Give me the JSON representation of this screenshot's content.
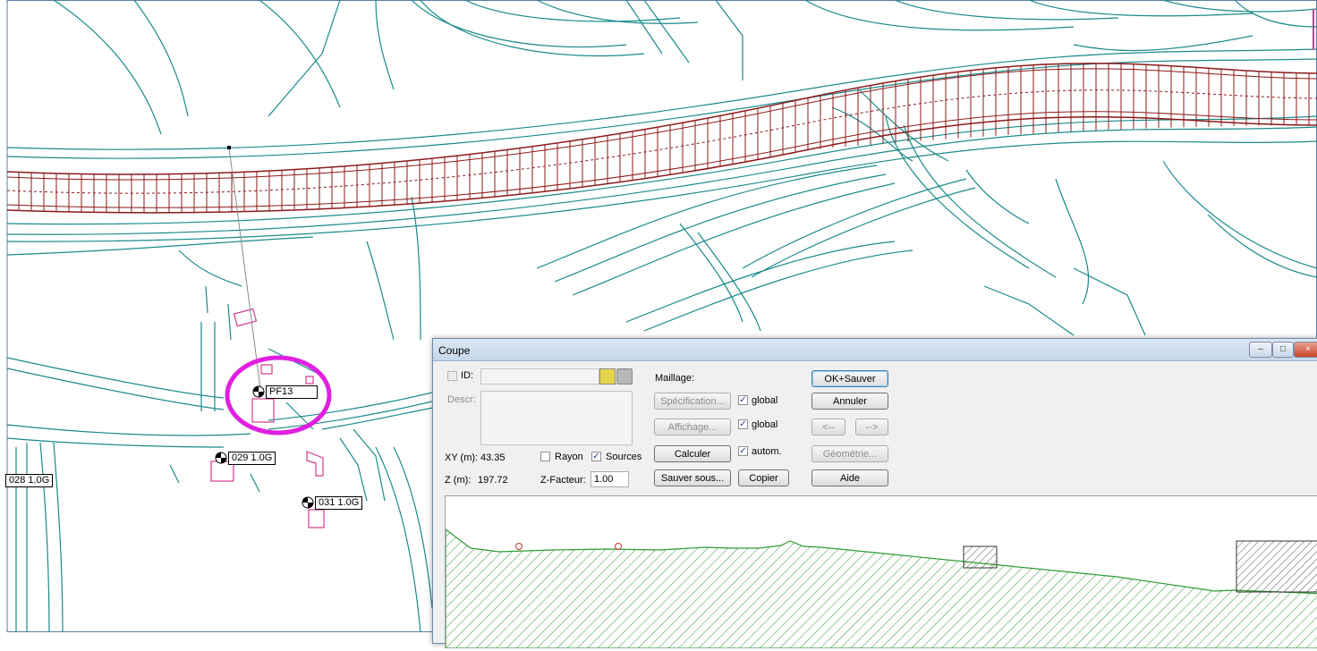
{
  "map": {
    "labels": {
      "pf13": "PF13",
      "r029": "029 1.0G",
      "r028": "028 1.0G",
      "r031": "031 1.0G"
    },
    "colors": {
      "road": "#1b8a8a",
      "bridge": "#8b1a1a",
      "building": "#d43a8c",
      "highlight": "#e020e0",
      "ground": "#2f9a35"
    }
  },
  "dialog": {
    "title": "Coupe",
    "id_label": "ID:",
    "id_value": "",
    "descr_label": "Descr:",
    "maillage_label": "Maillage:",
    "specification_button": "Spécification...",
    "affichage_button": "Affichage...",
    "calculer_button": "Calculer",
    "sauver_sous_button": "Sauver sous...",
    "copier_button": "Copier",
    "global1_label": "global",
    "global2_label": "global",
    "autom_label": "autom.",
    "ok_button": "OK+Sauver",
    "annuler_button": "Annuler",
    "prev_button": "<--",
    "next_button": "-->",
    "geometrie_button": "Géométrie...",
    "aide_button": "Aide",
    "xy_label": "XY (m):",
    "xy_value": "43.35",
    "z_label": "Z (m):",
    "z_value": "197.72",
    "rayon_label": "Rayon",
    "sources_label": "Sources",
    "zfacteur_label": "Z-Facteur:",
    "zfacteur_value": "1.00",
    "checks": {
      "global1": true,
      "global2": true,
      "autom": true,
      "rayon": false,
      "sources": true,
      "id": false
    }
  }
}
